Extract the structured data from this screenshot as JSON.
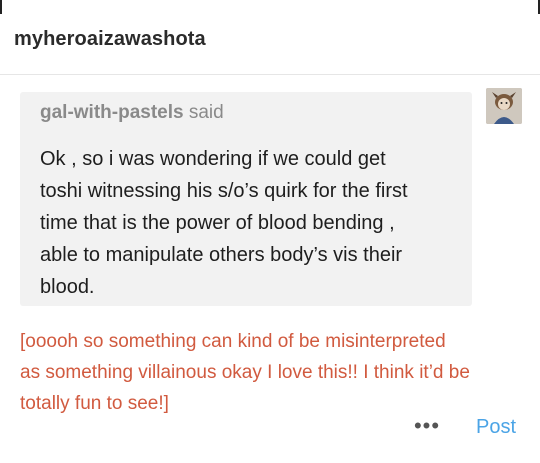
{
  "header": {
    "blog_name": "myheroaizawashota"
  },
  "quote": {
    "author": "gal-with-pastels",
    "said_label": "said",
    "lines": [
      "Ok , so i was wondering if we could get",
      "toshi witnessing his s/o’s quirk for the first",
      "time that is  the power of blood bending ,",
      "able to manipulate others body’s vis their",
      "blood."
    ]
  },
  "reply": {
    "lines": [
      "[ooooh so something can kind of be misinterpreted",
      "as something villainous okay I love this!! I think it’d be",
      "totally fun to see!]"
    ]
  },
  "footer": {
    "more_label": "•••",
    "post_label": "Post"
  },
  "colors": {
    "reply_text": "#d15a3f",
    "post_link": "#4ba4e6",
    "quote_bg": "#f2f2f2"
  },
  "icons": {
    "avatar": "user-avatar-icon"
  }
}
